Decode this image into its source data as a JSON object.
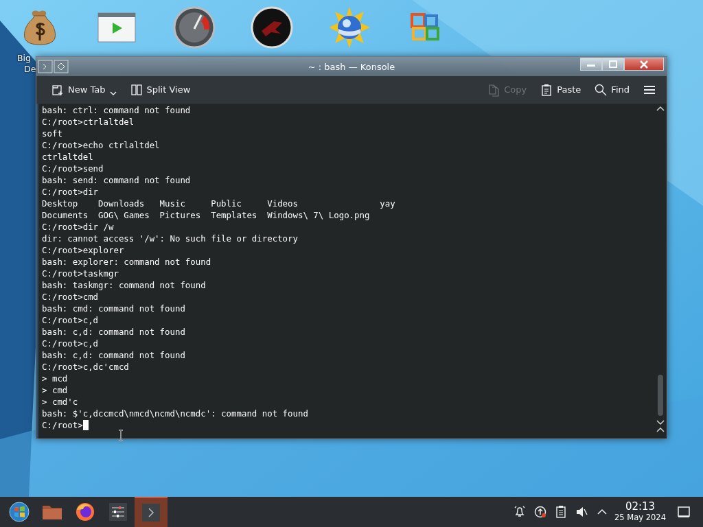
{
  "desktop_icons": [
    {
      "kind": "money-bag",
      "label_lines": [
        "Big",
        "De"
      ]
    },
    {
      "kind": "player"
    },
    {
      "kind": "gauge"
    },
    {
      "kind": "dark-disc"
    },
    {
      "kind": "globe"
    },
    {
      "kind": "office"
    }
  ],
  "window": {
    "title": "~ : bash — Konsole",
    "toolbar_left": [
      {
        "kind": "new-tab",
        "label": "New Tab",
        "dropdown": true
      },
      {
        "kind": "split",
        "label": "Split View",
        "dropdown": false
      }
    ],
    "toolbar_right": [
      {
        "kind": "copy",
        "label": "Copy",
        "disabled": true
      },
      {
        "kind": "paste",
        "label": "Paste",
        "disabled": false
      },
      {
        "kind": "find",
        "label": "Find",
        "disabled": false
      }
    ],
    "terminal_lines": [
      "bash: ctrl: command not found",
      "C:/root>ctrlaltdel",
      "soft",
      "C:/root>echo ctrlaltdel",
      "ctrlaltdel",
      "C:/root>send",
      "bash: send: command not found",
      "C:/root>dir",
      "Desktop    Downloads   Music     Public     Videos                yay",
      "Documents  GOG\\ Games  Pictures  Templates  Windows\\ 7\\ Logo.png",
      "C:/root>dir /w",
      "dir: cannot access '/w': No such file or directory",
      "C:/root>explorer",
      "bash: explorer: command not found",
      "C:/root>taskmgr",
      "bash: taskmgr: command not found",
      "C:/root>cmd",
      "bash: cmd: command not found",
      "C:/root>c,d",
      "bash: c,d: command not found",
      "C:/root>c,d",
      "bash: c,d: command not found",
      "C:/root>c,dc'cmcd",
      "> mcd",
      "> cmd",
      "> cmd'c",
      "bash: $'c,dccmcd\\nmcd\\ncmd\\ncmdc': command not found"
    ],
    "prompt": "C:/root>"
  },
  "taskbar": {
    "apps": [
      {
        "kind": "start",
        "selected": false
      },
      {
        "kind": "folder",
        "selected": false
      },
      {
        "kind": "firefox",
        "selected": false
      },
      {
        "kind": "mixer",
        "selected": false
      },
      {
        "kind": "terminal",
        "selected": true
      }
    ],
    "tray": [
      {
        "kind": "bell"
      },
      {
        "kind": "update"
      },
      {
        "kind": "clipboard"
      },
      {
        "kind": "muted"
      },
      {
        "kind": "expand"
      }
    ],
    "time": "02:13",
    "date": "25 May 2024"
  }
}
